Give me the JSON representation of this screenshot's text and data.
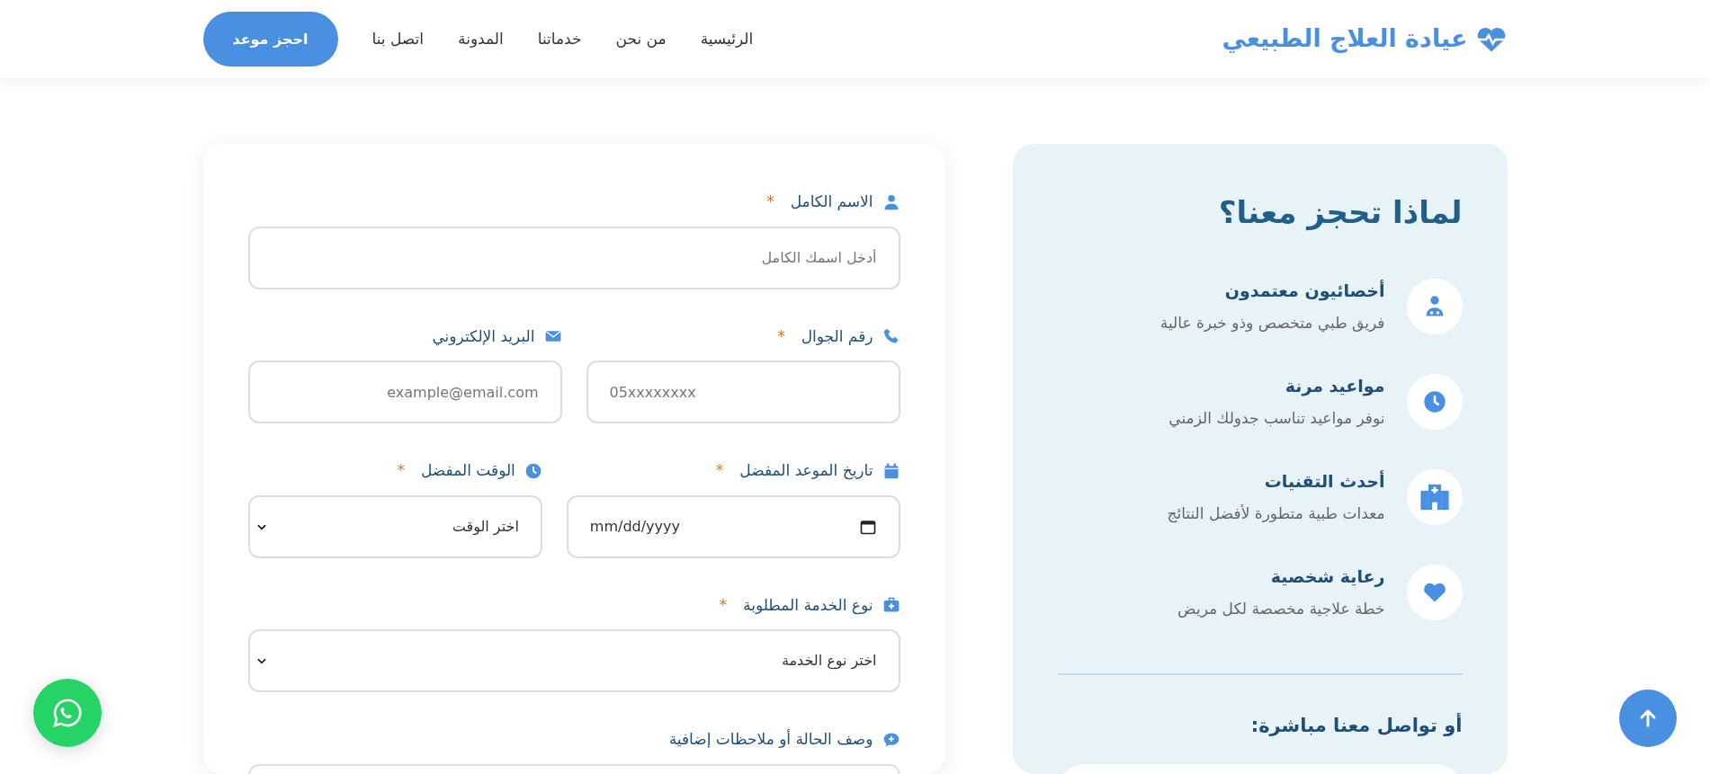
{
  "header": {
    "logo": "عيادة العلاج الطبيعي",
    "nav": [
      {
        "label": "الرئيسية"
      },
      {
        "label": "من نحن"
      },
      {
        "label": "خدماتنا"
      },
      {
        "label": "المدونة"
      },
      {
        "label": "اتصل بنا"
      }
    ],
    "cta": "احجز موعد"
  },
  "form": {
    "rows": [
      [
        {
          "kind": "text",
          "label": "الاسم الكامل",
          "required_mark": "*",
          "placeholder": "أدخل اسمك الكامل"
        }
      ],
      [
        {
          "kind": "tel",
          "label": "رقم الجوال",
          "required_mark": "*",
          "placeholder": "05xxxxxxxx"
        },
        {
          "kind": "email",
          "label": "البريد الإلكتروني",
          "placeholder": "example@email.com"
        }
      ],
      [
        {
          "kind": "date",
          "label": "تاريخ الموعد المفضل",
          "required_mark": "*",
          "value": "mm/dd/yyyy"
        },
        {
          "kind": "select",
          "label": "الوقت المفضل",
          "required_mark": "*",
          "value": "اختر الوقت"
        }
      ],
      [
        {
          "kind": "select",
          "label": "نوع الخدمة المطلوبة",
          "required_mark": "*",
          "value": "اختر نوع الخدمة"
        }
      ],
      [
        {
          "kind": "textarea",
          "label": "وصف الحالة أو ملاحظات إضافية"
        }
      ]
    ]
  },
  "why": {
    "title": "لماذا تحجز معنا؟",
    "items": [
      {
        "title": "أخصائيون معتمدون",
        "description": "فريق طبي متخصص وذو خبرة عالية"
      },
      {
        "title": "مواعيد مرنة",
        "description": "نوفر مواعيد تناسب جدولك الزمني"
      },
      {
        "title": "أحدث التقنيات",
        "description": "معدات طبية متطورة لأفضل النتائج"
      },
      {
        "title": "رعاية شخصية",
        "description": "خطة علاجية مخصصة لكل مريض"
      }
    ],
    "contact_title": "أو تواصل معنا مباشرة:"
  }
}
